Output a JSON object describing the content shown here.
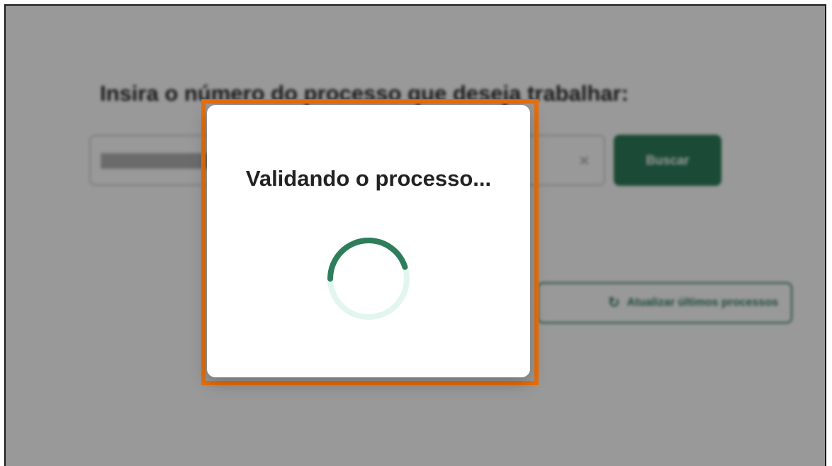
{
  "background_page": {
    "prompt_title": "Insira o número do processo que deseja trabalhar:",
    "search": {
      "value": "████████████",
      "clear_glyph": "×"
    },
    "search_button_label": "Buscar",
    "refresh_button": {
      "icon": "refresh-icon",
      "icon_glyph": "↻",
      "label": "Atualizar últimos processos"
    }
  },
  "modal": {
    "title": "Validando o processo...",
    "spinner": {
      "icon": "loading-spinner",
      "progress": 0.45
    }
  },
  "colors": {
    "accent_green": "#2e7d5b",
    "spinner_track": "#e3f5ef",
    "highlight_orange": "#e86f0c",
    "overlay": "rgba(0,0,0,0.40)"
  }
}
